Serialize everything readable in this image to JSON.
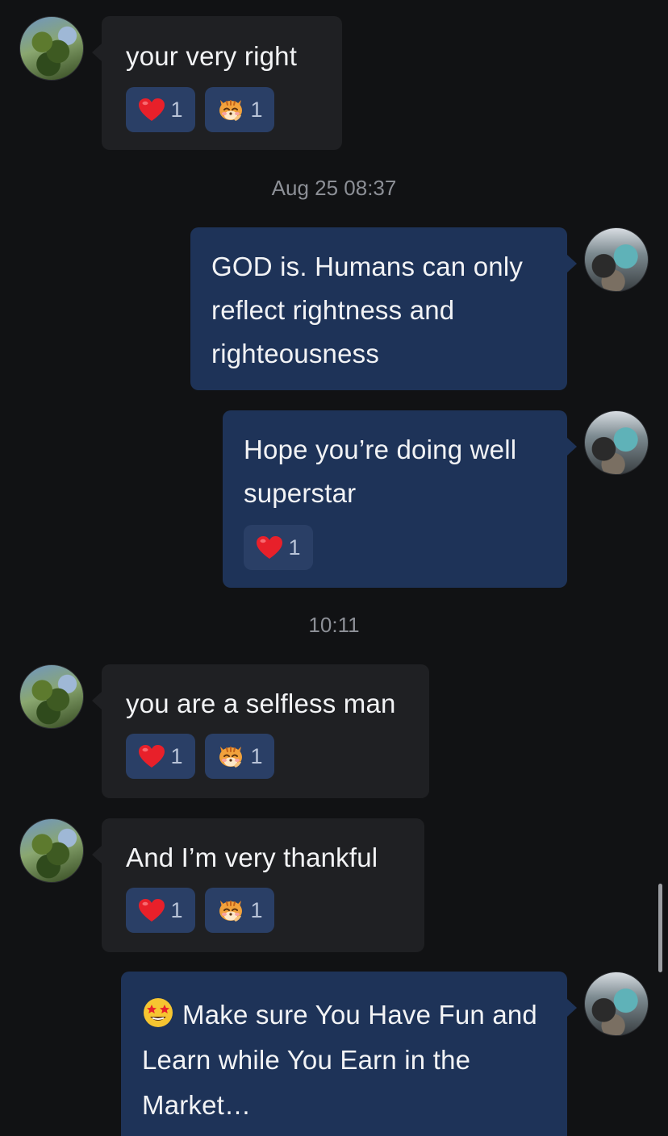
{
  "messages": [
    {
      "text": "your very right",
      "reactions": [
        {
          "emoji": "heart",
          "count": "1"
        },
        {
          "emoji": "tiger-face",
          "count": "1"
        }
      ]
    },
    {
      "text": "GOD is. Humans can only reflect rightness and righteousness"
    },
    {
      "text": "Hope you’re doing well superstar",
      "reactions": [
        {
          "emoji": "heart",
          "count": "1"
        }
      ]
    },
    {
      "text": "you are a selfless man",
      "reactions": [
        {
          "emoji": "heart",
          "count": "1"
        },
        {
          "emoji": "tiger-face",
          "count": "1"
        }
      ]
    },
    {
      "text": "And I’m very thankful",
      "reactions": [
        {
          "emoji": "heart",
          "count": "1"
        },
        {
          "emoji": "tiger-face",
          "count": "1"
        }
      ]
    },
    {
      "emoji": "star-struck",
      "text": "Make sure You Have Fun and Learn while You Earn in the Market…"
    }
  ],
  "timestamps": [
    "Aug 25 08:37",
    "10:11"
  ],
  "colors": {
    "background": "#111214",
    "incoming_bubble": "#1f2023",
    "outgoing_bubble": "#1e3358",
    "reaction_chip": "#2a3f66",
    "timestamp_text": "#8c8f96"
  }
}
